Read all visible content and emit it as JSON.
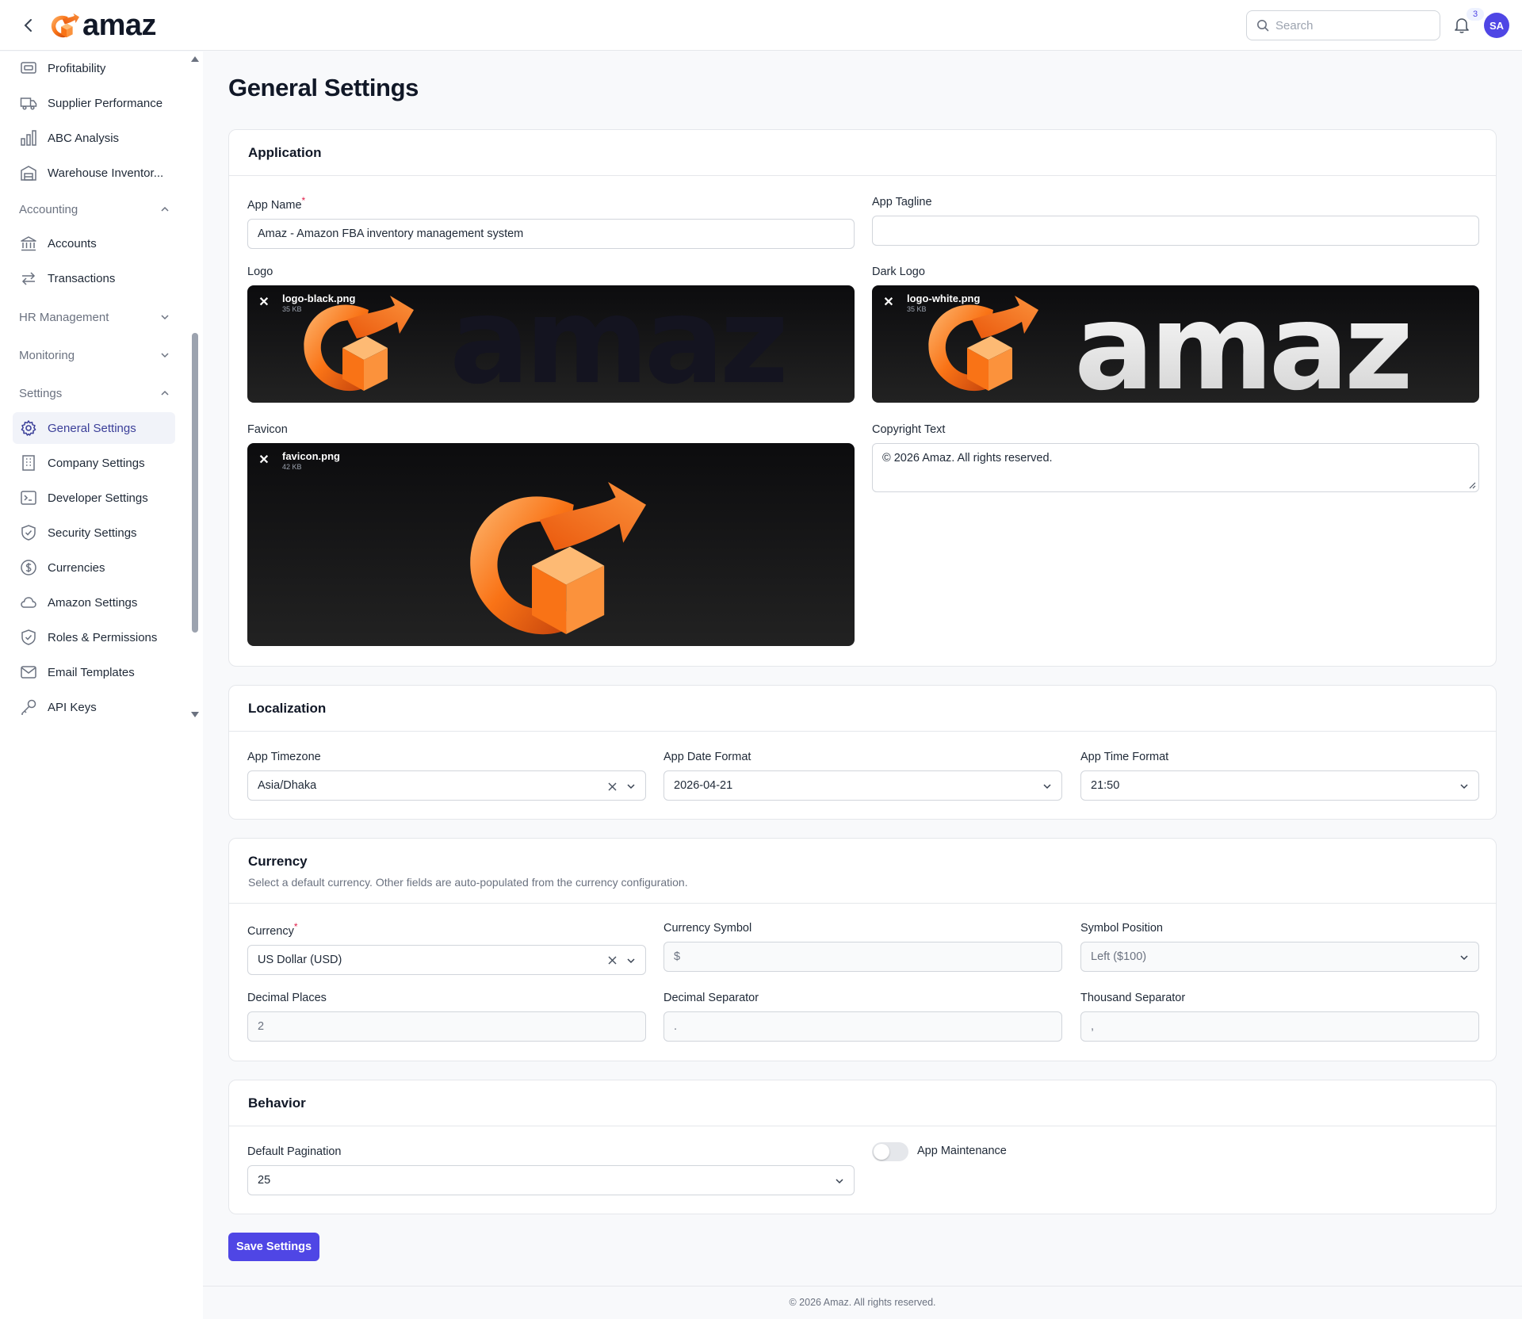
{
  "header": {
    "brand": "amaz",
    "search_placeholder": "Search",
    "notification_count": "3",
    "user_initials": "SA"
  },
  "sidebar": {
    "items": [
      {
        "label": "Profitability",
        "icon": "receipt-icon"
      },
      {
        "label": "Supplier Performance",
        "icon": "truck-icon"
      },
      {
        "label": "ABC Analysis",
        "icon": "bar-chart-icon"
      },
      {
        "label": "Warehouse Inventor...",
        "icon": "warehouse-icon"
      }
    ],
    "groups": {
      "accounting": "Accounting",
      "hr": "HR Management",
      "monitoring": "Monitoring",
      "settings": "Settings"
    },
    "accounting_items": [
      {
        "label": "Accounts",
        "icon": "bank-icon"
      },
      {
        "label": "Transactions",
        "icon": "swap-icon"
      }
    ],
    "settings_items": [
      {
        "label": "General Settings",
        "icon": "gear-icon",
        "active": true
      },
      {
        "label": "Company Settings",
        "icon": "building-icon"
      },
      {
        "label": "Developer Settings",
        "icon": "terminal-icon"
      },
      {
        "label": "Security Settings",
        "icon": "shield-icon"
      },
      {
        "label": "Currencies",
        "icon": "dollar-circle-icon"
      },
      {
        "label": "Amazon Settings",
        "icon": "cloud-icon"
      },
      {
        "label": "Roles & Permissions",
        "icon": "shield-check-icon"
      },
      {
        "label": "Email Templates",
        "icon": "mail-icon"
      },
      {
        "label": "API Keys",
        "icon": "key-icon"
      }
    ]
  },
  "page": {
    "title": "General Settings"
  },
  "application": {
    "title": "Application",
    "app_name_label": "App Name",
    "app_name_value": "Amaz - Amazon FBA inventory management system",
    "app_tagline_label": "App Tagline",
    "app_tagline_value": "",
    "logo_label": "Logo",
    "logo_file": "logo-black.png",
    "logo_size": "35 KB",
    "dark_logo_label": "Dark Logo",
    "dark_logo_file": "logo-white.png",
    "dark_logo_size": "35 KB",
    "favicon_label": "Favicon",
    "favicon_file": "favicon.png",
    "favicon_size": "42 KB",
    "logo_wordmark": "amaz",
    "copyright_label": "Copyright Text",
    "copyright_value": "© 2026 Amaz. All rights reserved."
  },
  "localization": {
    "title": "Localization",
    "timezone_label": "App Timezone",
    "timezone_value": "Asia/Dhaka",
    "date_format_label": "App Date Format",
    "date_format_value": "2026-04-21",
    "time_format_label": "App Time Format",
    "time_format_value": "21:50"
  },
  "currency": {
    "title": "Currency",
    "description": "Select a default currency. Other fields are auto-populated from the currency configuration.",
    "currency_label": "Currency",
    "currency_value": "US Dollar (USD)",
    "symbol_label": "Currency Symbol",
    "symbol_value": "$",
    "position_label": "Symbol Position",
    "position_value": "Left ($100)",
    "decimal_places_label": "Decimal Places",
    "decimal_places_value": "2",
    "decimal_sep_label": "Decimal Separator",
    "decimal_sep_value": ".",
    "thousand_sep_label": "Thousand Separator",
    "thousand_sep_value": ","
  },
  "behavior": {
    "title": "Behavior",
    "pagination_label": "Default Pagination",
    "pagination_value": "25",
    "maintenance_label": "App Maintenance",
    "maintenance_on": false
  },
  "actions": {
    "save_label": "Save Settings"
  },
  "footer": {
    "text": "© 2026 Amaz. All rights reserved."
  },
  "colors": {
    "accent": "#4f46e5",
    "logo_orange": "#f97316",
    "required": "#e11d48"
  }
}
